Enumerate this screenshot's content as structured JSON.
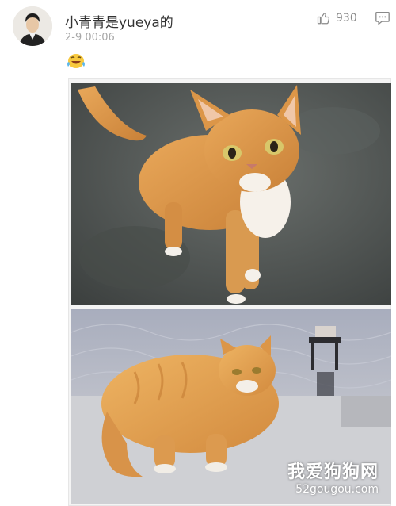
{
  "post": {
    "username": "小青青是yueya的",
    "timestamp": "2-9 00:06",
    "like_count": "930",
    "like_icon": "thumbs-up-icon",
    "comment_icon": "comment-icon",
    "emoji": "laughing-face-emoji"
  },
  "watermark": {
    "title": "我爱狗狗网",
    "url": "52gougou.com"
  },
  "colors": {
    "text_primary": "#333333",
    "text_secondary": "#a7a7a7",
    "icon_gray": "#8a8a8a"
  }
}
